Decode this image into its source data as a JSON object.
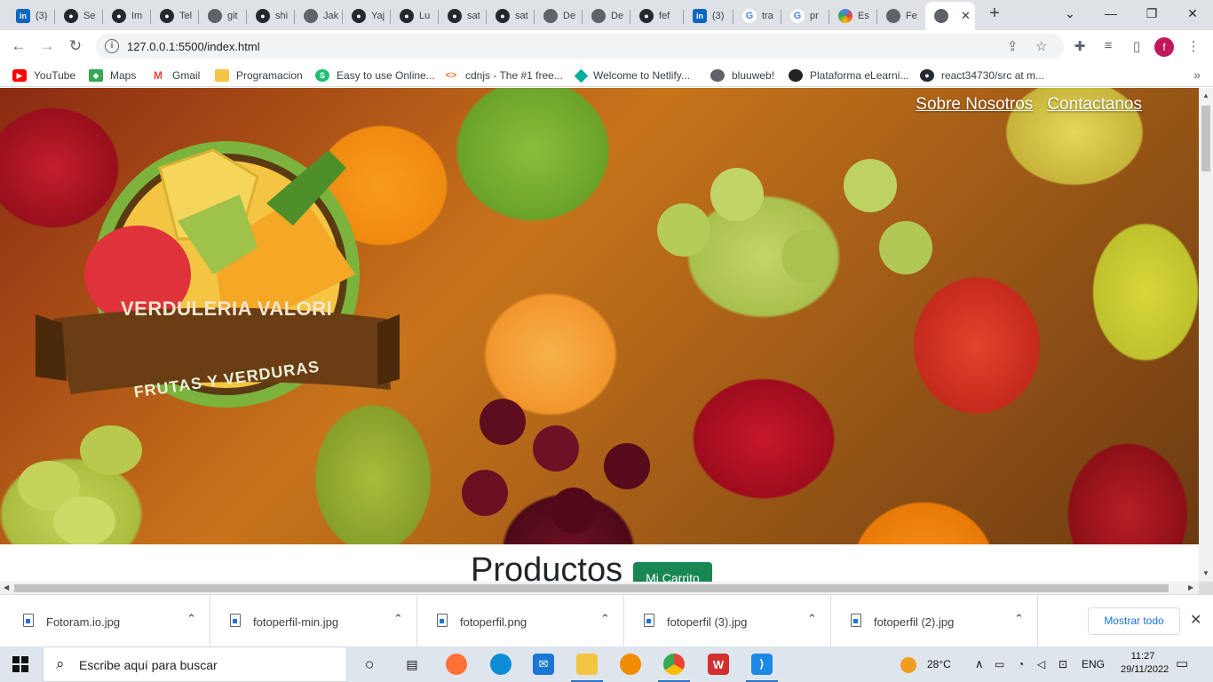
{
  "browser": {
    "tabs": [
      {
        "label": "(3)",
        "favicon": "linkedin-icon",
        "active": false
      },
      {
        "label": "Se",
        "favicon": "github-icon",
        "active": false
      },
      {
        "label": "Im",
        "favicon": "github-icon",
        "active": false
      },
      {
        "label": "Tel",
        "favicon": "github-icon",
        "active": false
      },
      {
        "label": "git",
        "favicon": "globe-icon",
        "active": false
      },
      {
        "label": "shi",
        "favicon": "github-icon",
        "active": false
      },
      {
        "label": "Jak",
        "favicon": "globe-icon",
        "active": false
      },
      {
        "label": "Yaj",
        "favicon": "github-icon",
        "active": false
      },
      {
        "label": "Lu",
        "favicon": "github-icon",
        "active": false
      },
      {
        "label": "sat",
        "favicon": "github-icon",
        "active": false
      },
      {
        "label": "sat",
        "favicon": "github-icon",
        "active": false
      },
      {
        "label": "De",
        "favicon": "globe-icon",
        "active": false
      },
      {
        "label": "De",
        "favicon": "globe-icon",
        "active": false
      },
      {
        "label": "fef",
        "favicon": "github-icon",
        "active": false
      },
      {
        "label": "(3)",
        "favicon": "linkedin-icon",
        "active": false
      },
      {
        "label": "tra",
        "favicon": "google-icon",
        "active": false
      },
      {
        "label": "pr",
        "favicon": "google-icon",
        "active": false
      },
      {
        "label": "Es",
        "favicon": "ring-icon",
        "active": false
      },
      {
        "label": "Fe",
        "favicon": "globe-icon",
        "active": false
      },
      {
        "label": "",
        "favicon": "globe-icon",
        "active": true
      }
    ],
    "url": "127.0.0.1:5500/index.html",
    "bookmarks": [
      {
        "label": "YouTube",
        "icon": "youtube-icon",
        "color": "#ff0000"
      },
      {
        "label": "Maps",
        "icon": "maps-icon",
        "color": "#34a853"
      },
      {
        "label": "Gmail",
        "icon": "gmail-icon",
        "color": "#ea4335"
      },
      {
        "label": "Programacion",
        "icon": "folder-icon",
        "color": "#f4c542"
      },
      {
        "label": "Easy to use Online...",
        "icon": "s-icon",
        "color": "#1dbf73"
      },
      {
        "label": "cdnjs - The #1 free...",
        "icon": "code-icon",
        "color": "#e8743b"
      },
      {
        "label": "Welcome to Netlify...",
        "icon": "netlify-icon",
        "color": "#00ad9f"
      },
      {
        "label": "bluuweb!",
        "icon": "globe-icon",
        "color": "#5f6368"
      },
      {
        "label": "Plataforma eLearni...",
        "icon": "elearning-icon",
        "color": "#222222"
      },
      {
        "label": "react34730/src at m...",
        "icon": "github-icon",
        "color": "#24292f"
      }
    ]
  },
  "page": {
    "nav": {
      "about": "Sobre Nosotros",
      "contact": "Contactanos"
    },
    "logo": {
      "name": "VERDULERIA VALORI",
      "tagline": "FRUTAS Y VERDURAS"
    },
    "products_title": "Productos",
    "cart_button": "Mi Carrito",
    "cart_color": "#198754"
  },
  "downloads": {
    "items": [
      "Fotoram.io.jpg",
      "fotoperfil-min.jpg",
      "fotoperfil.png",
      "fotoperfil (3).jpg",
      "fotoperfil (2).jpg"
    ],
    "show_all": "Mostrar todo"
  },
  "taskbar": {
    "search_placeholder": "Escribe aquí para buscar",
    "temperature": "28°C",
    "language": "ENG",
    "time": "11:27",
    "date": "29/11/2022"
  }
}
